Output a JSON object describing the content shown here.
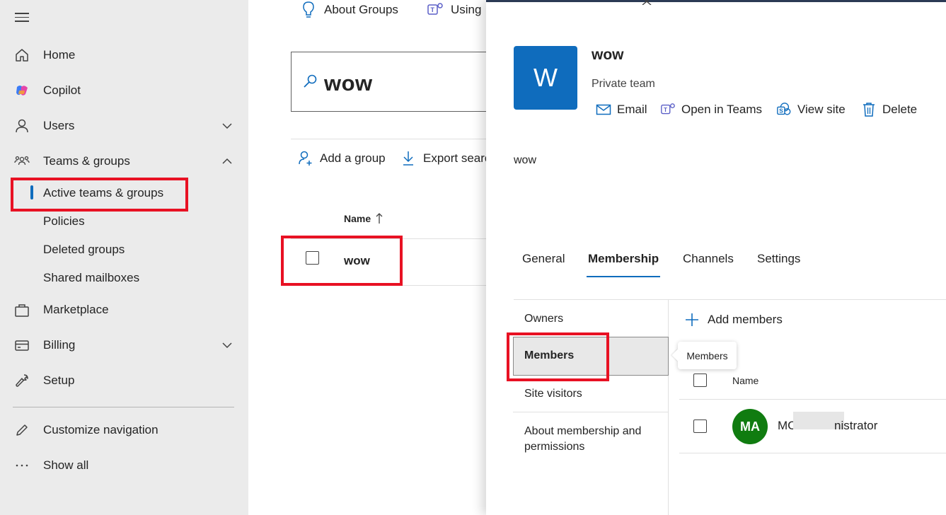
{
  "sidebar": {
    "items": [
      {
        "label": "Home",
        "icon": "home-icon"
      },
      {
        "label": "Copilot",
        "icon": "copilot-icon"
      },
      {
        "label": "Users",
        "icon": "person-icon"
      },
      {
        "label": "Teams & groups",
        "icon": "people-team-icon"
      },
      {
        "label": "Marketplace",
        "icon": "shopping-bag-icon"
      },
      {
        "label": "Billing",
        "icon": "credit-card-icon"
      },
      {
        "label": "Setup",
        "icon": "wrench-icon"
      }
    ],
    "sub_items": [
      "Active teams & groups",
      "Policies",
      "Deleted groups",
      "Shared mailboxes"
    ],
    "footer": [
      {
        "label": "Customize navigation",
        "icon": "pencil-icon"
      },
      {
        "label": "Show all",
        "icon": "more-horizontal-icon"
      }
    ]
  },
  "main": {
    "links": [
      "About Groups",
      "Using"
    ],
    "search_value": "wow",
    "toolbar": {
      "add_group": "Add a group",
      "export": "Export searc"
    },
    "table": {
      "header": "Name",
      "rows": [
        "wow"
      ]
    }
  },
  "panel": {
    "tile_letter": "W",
    "title": "wow",
    "subtitle": "Private team",
    "actions": [
      "Email",
      "Open in Teams",
      "View site",
      "Delete"
    ],
    "description": "wow",
    "tabs": [
      "General",
      "Membership",
      "Channels",
      "Settings"
    ],
    "left_nav": {
      "owners": "Owners",
      "members": "Members",
      "site_visitors": "Site visitors",
      "about": "About membership and permissions"
    },
    "add_members": "Add members",
    "tooltip": "Members",
    "members_table": {
      "header": "Name",
      "rows": [
        {
          "initials": "MA",
          "name_start": "MC",
          "name_end": "nistrator"
        }
      ]
    }
  },
  "colors": {
    "accent": "#0f6cbd",
    "highlight": "#e81123",
    "avatar": "#107c10"
  }
}
